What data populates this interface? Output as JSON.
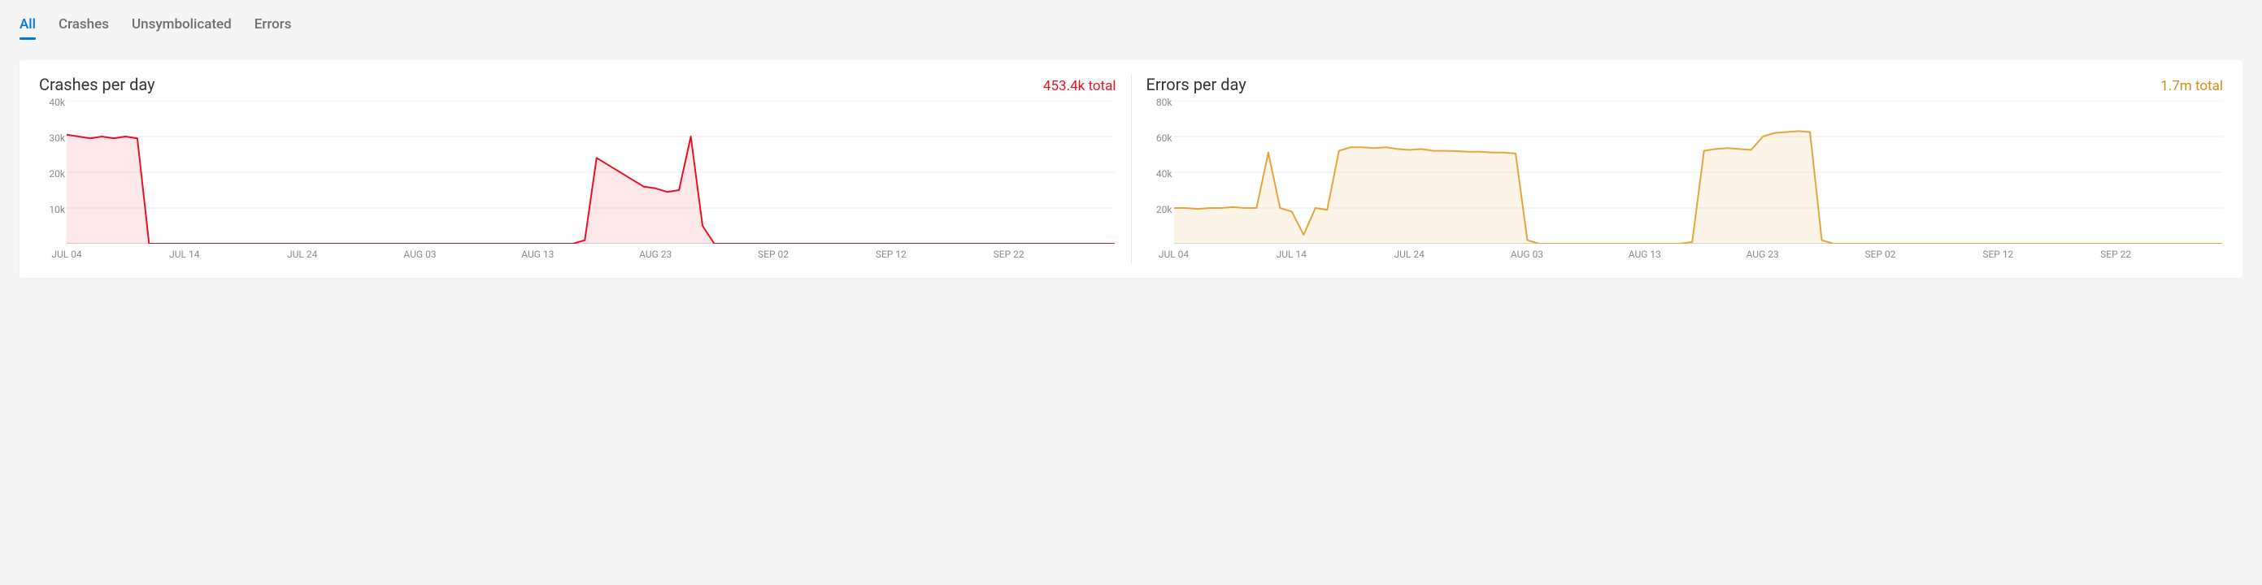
{
  "tabs": [
    {
      "id": "all",
      "label": "All",
      "active": true
    },
    {
      "id": "crashes",
      "label": "Crashes",
      "active": false
    },
    {
      "id": "unsymbolicated",
      "label": "Unsymbolicated",
      "active": false
    },
    {
      "id": "errors",
      "label": "Errors",
      "active": false
    }
  ],
  "panels": [
    {
      "id": "crashes-chart",
      "title": "Crashes per day",
      "total": "453.4k total",
      "totalClass": "total-red",
      "stroke": "#e81123",
      "fill": "rgba(232,17,35,0.10)"
    },
    {
      "id": "errors-chart",
      "title": "Errors per day",
      "total": "1.7m total",
      "totalClass": "total-orange",
      "stroke": "#e8a33d",
      "fill": "rgba(232,163,61,0.12)"
    }
  ],
  "chart_data": [
    {
      "type": "area",
      "title": "Crashes per day",
      "xlabel": "",
      "ylabel": "",
      "ylim": [
        0,
        40000
      ],
      "y_ticks": [
        10000,
        20000,
        30000,
        40000
      ],
      "y_tick_labels": [
        "10k",
        "20k",
        "30k",
        "40k"
      ],
      "x_tick_labels": [
        "JUL 04",
        "JUL 14",
        "JUL 24",
        "AUG 03",
        "AUG 13",
        "AUG 23",
        "SEP 02",
        "SEP 12",
        "SEP 22"
      ],
      "total_label": "453.4k total",
      "series": [
        {
          "name": "Crashes",
          "color": "#e81123",
          "x": [
            0,
            1,
            2,
            3,
            4,
            5,
            6,
            7,
            8,
            9,
            10,
            11,
            12,
            13,
            14,
            15,
            16,
            17,
            18,
            19,
            20,
            21,
            22,
            23,
            24,
            25,
            26,
            27,
            28,
            29,
            30,
            31,
            32,
            33,
            34,
            35,
            36,
            37,
            38,
            39,
            40,
            41,
            42,
            43,
            44,
            45,
            46,
            47,
            48,
            49,
            50,
            51,
            52,
            53,
            54,
            55,
            56,
            57,
            58,
            59,
            60,
            61,
            62,
            63,
            64,
            65,
            66,
            67,
            68,
            69,
            70,
            71,
            72,
            73,
            74,
            75,
            76,
            77,
            78,
            79,
            80,
            81,
            82,
            83,
            84,
            85,
            86,
            87,
            88,
            89
          ],
          "values": [
            30500,
            30000,
            29500,
            30000,
            29500,
            30000,
            29500,
            0,
            0,
            0,
            0,
            0,
            0,
            0,
            0,
            0,
            0,
            0,
            0,
            0,
            0,
            0,
            0,
            0,
            0,
            0,
            0,
            0,
            0,
            0,
            0,
            0,
            0,
            0,
            0,
            0,
            0,
            0,
            0,
            0,
            0,
            0,
            0,
            0,
            1000,
            24000,
            22000,
            20000,
            18000,
            16000,
            15500,
            14500,
            15000,
            30000,
            5000,
            0,
            0,
            0,
            0,
            0,
            0,
            0,
            0,
            0,
            0,
            0,
            0,
            0,
            0,
            0,
            0,
            0,
            0,
            0,
            0,
            0,
            0,
            0,
            0,
            0,
            0,
            0,
            0,
            0,
            0,
            0,
            0,
            0,
            0,
            0
          ]
        }
      ]
    },
    {
      "type": "area",
      "title": "Errors per day",
      "xlabel": "",
      "ylabel": "",
      "ylim": [
        0,
        80000
      ],
      "y_ticks": [
        20000,
        40000,
        60000,
        80000
      ],
      "y_tick_labels": [
        "20k",
        "40k",
        "60k",
        "80k"
      ],
      "x_tick_labels": [
        "JUL 04",
        "JUL 14",
        "JUL 24",
        "AUG 03",
        "AUG 13",
        "AUG 23",
        "SEP 02",
        "SEP 12",
        "SEP 22"
      ],
      "total_label": "1.7m total",
      "series": [
        {
          "name": "Errors",
          "color": "#e8a33d",
          "x": [
            0,
            1,
            2,
            3,
            4,
            5,
            6,
            7,
            8,
            9,
            10,
            11,
            12,
            13,
            14,
            15,
            16,
            17,
            18,
            19,
            20,
            21,
            22,
            23,
            24,
            25,
            26,
            27,
            28,
            29,
            30,
            31,
            32,
            33,
            34,
            35,
            36,
            37,
            38,
            39,
            40,
            41,
            42,
            43,
            44,
            45,
            46,
            47,
            48,
            49,
            50,
            51,
            52,
            53,
            54,
            55,
            56,
            57,
            58,
            59,
            60,
            61,
            62,
            63,
            64,
            65,
            66,
            67,
            68,
            69,
            70,
            71,
            72,
            73,
            74,
            75,
            76,
            77,
            78,
            79,
            80,
            81,
            82,
            83,
            84,
            85,
            86,
            87,
            88,
            89
          ],
          "values": [
            20000,
            20000,
            19500,
            20000,
            20000,
            20500,
            20000,
            20000,
            51000,
            20000,
            18000,
            5000,
            20000,
            19000,
            52000,
            54000,
            54000,
            53500,
            54000,
            53000,
            52500,
            53000,
            52000,
            52000,
            51800,
            51500,
            51500,
            51000,
            51000,
            50500,
            2000,
            0,
            0,
            0,
            0,
            0,
            0,
            0,
            0,
            0,
            0,
            0,
            0,
            0,
            1000,
            52000,
            53000,
            53500,
            53000,
            52500,
            60000,
            62000,
            62500,
            63000,
            62500,
            2000,
            0,
            0,
            0,
            0,
            0,
            0,
            0,
            0,
            0,
            0,
            0,
            0,
            0,
            0,
            0,
            0,
            0,
            0,
            0,
            0,
            0,
            0,
            0,
            0,
            0,
            0,
            0,
            0,
            0,
            0,
            0,
            0,
            0,
            0
          ]
        }
      ]
    }
  ]
}
